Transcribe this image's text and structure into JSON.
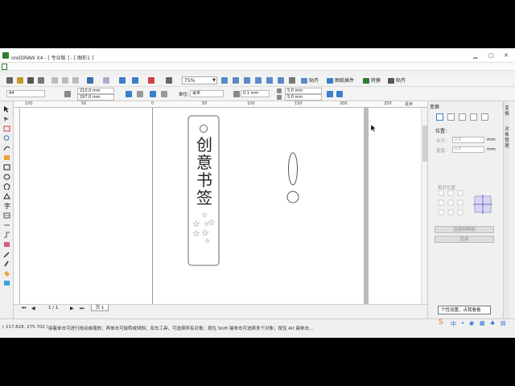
{
  "window": {
    "title": "orelDRAW X4 - [ 专业版 ] - [ 图形1 ]",
    "controls": [
      "▁",
      "▢",
      "✕"
    ]
  },
  "toolbar": {
    "zoom_value": "75%",
    "buttons": [
      {
        "label": "贴齐",
        "icon": "snap-icon"
      },
      {
        "label": "图纸插件",
        "icon": "plugin-icon"
      },
      {
        "label": "转换",
        "icon": "convert-icon"
      },
      {
        "label": "贴齐",
        "icon": "align-icon"
      }
    ]
  },
  "propertybar": {
    "paper_size": "A4",
    "width": "210.0 mm",
    "height": "297.0 mm",
    "units_label": "单位:",
    "units_value": "毫米",
    "nudge": "0.1 mm",
    "dup_x": "5.0 mm",
    "dup_y": "5.0 mm"
  },
  "ruler": {
    "h_ticks": [
      "100",
      "50",
      "0",
      "50",
      "100",
      "150",
      "200",
      "250"
    ],
    "unit": "毫米"
  },
  "canvas": {
    "bookmark_text": [
      "创",
      "意",
      "书",
      "签"
    ],
    "stars": [
      "☆",
      "☆",
      "☆",
      "☆",
      "☆",
      "☆",
      "☆"
    ]
  },
  "navigator": {
    "page_count": "1 / 1",
    "page_tab": "页 1"
  },
  "docker": {
    "title": "变换",
    "position_label": "位置：",
    "x_label": "水平：",
    "x_value": "0.0",
    "y_label": "垂直：",
    "y_value": "0.0",
    "unit": "mm",
    "relative_label": "相对位置",
    "apply_copy": "应用到再制",
    "apply": "应用",
    "side_tabs": [
      "变",
      "换",
      "对",
      "象",
      "管",
      "理"
    ]
  },
  "statusbar": {
    "coords": "( 217.828, 275.702 )",
    "message": "接着单击可进行拖动或缩放；再单击可旋转或倾斜；双击工具，可选择所有对象；按住 Shift 键单击可选择多个对象；按住 Alt 键单击..."
  },
  "tooltip": {
    "text": "个性设置，点我看看"
  },
  "colors": {
    "accent": "#2e7d32",
    "tray_blue": "#1e6fd9",
    "ime_orange": "#f26b1d"
  }
}
